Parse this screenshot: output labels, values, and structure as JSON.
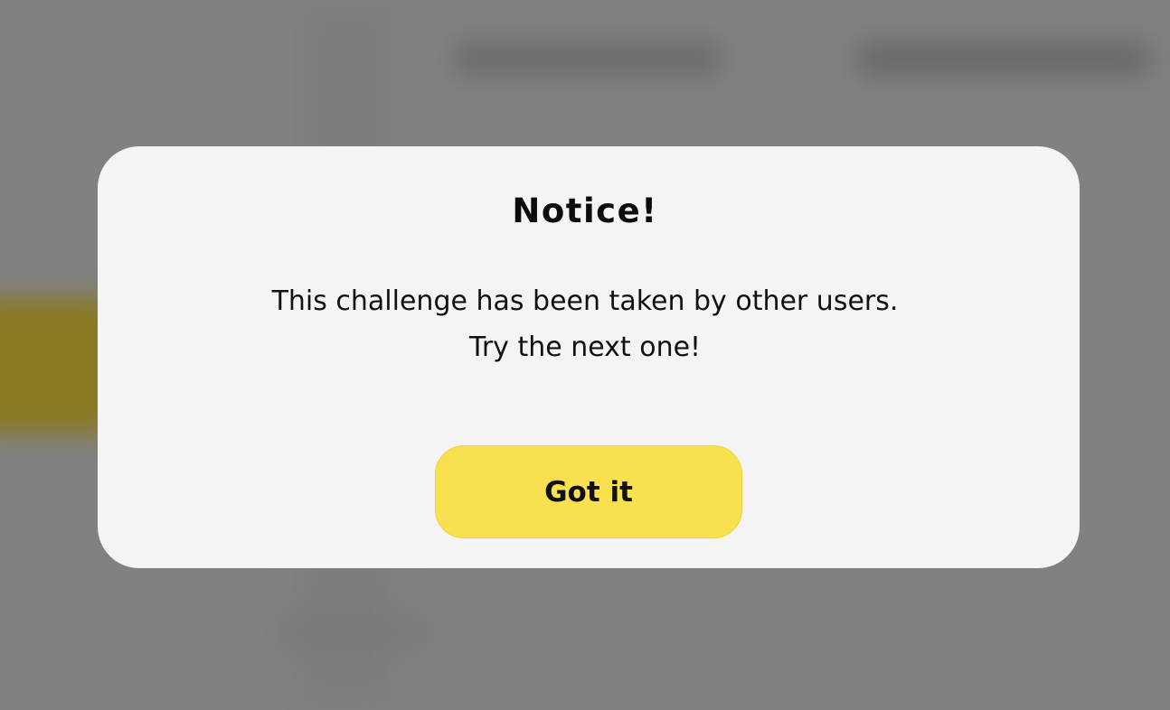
{
  "dialog": {
    "title": "Notice!",
    "message_line1": "This challenge has been taken by other users.",
    "message_line2": "Try the next one!",
    "confirm_label": "Got it"
  },
  "colors": {
    "overlay": "#7e7e7e",
    "dialog_background": "#f4f4f4",
    "button_background": "#f9e04e",
    "text": "#111111"
  }
}
